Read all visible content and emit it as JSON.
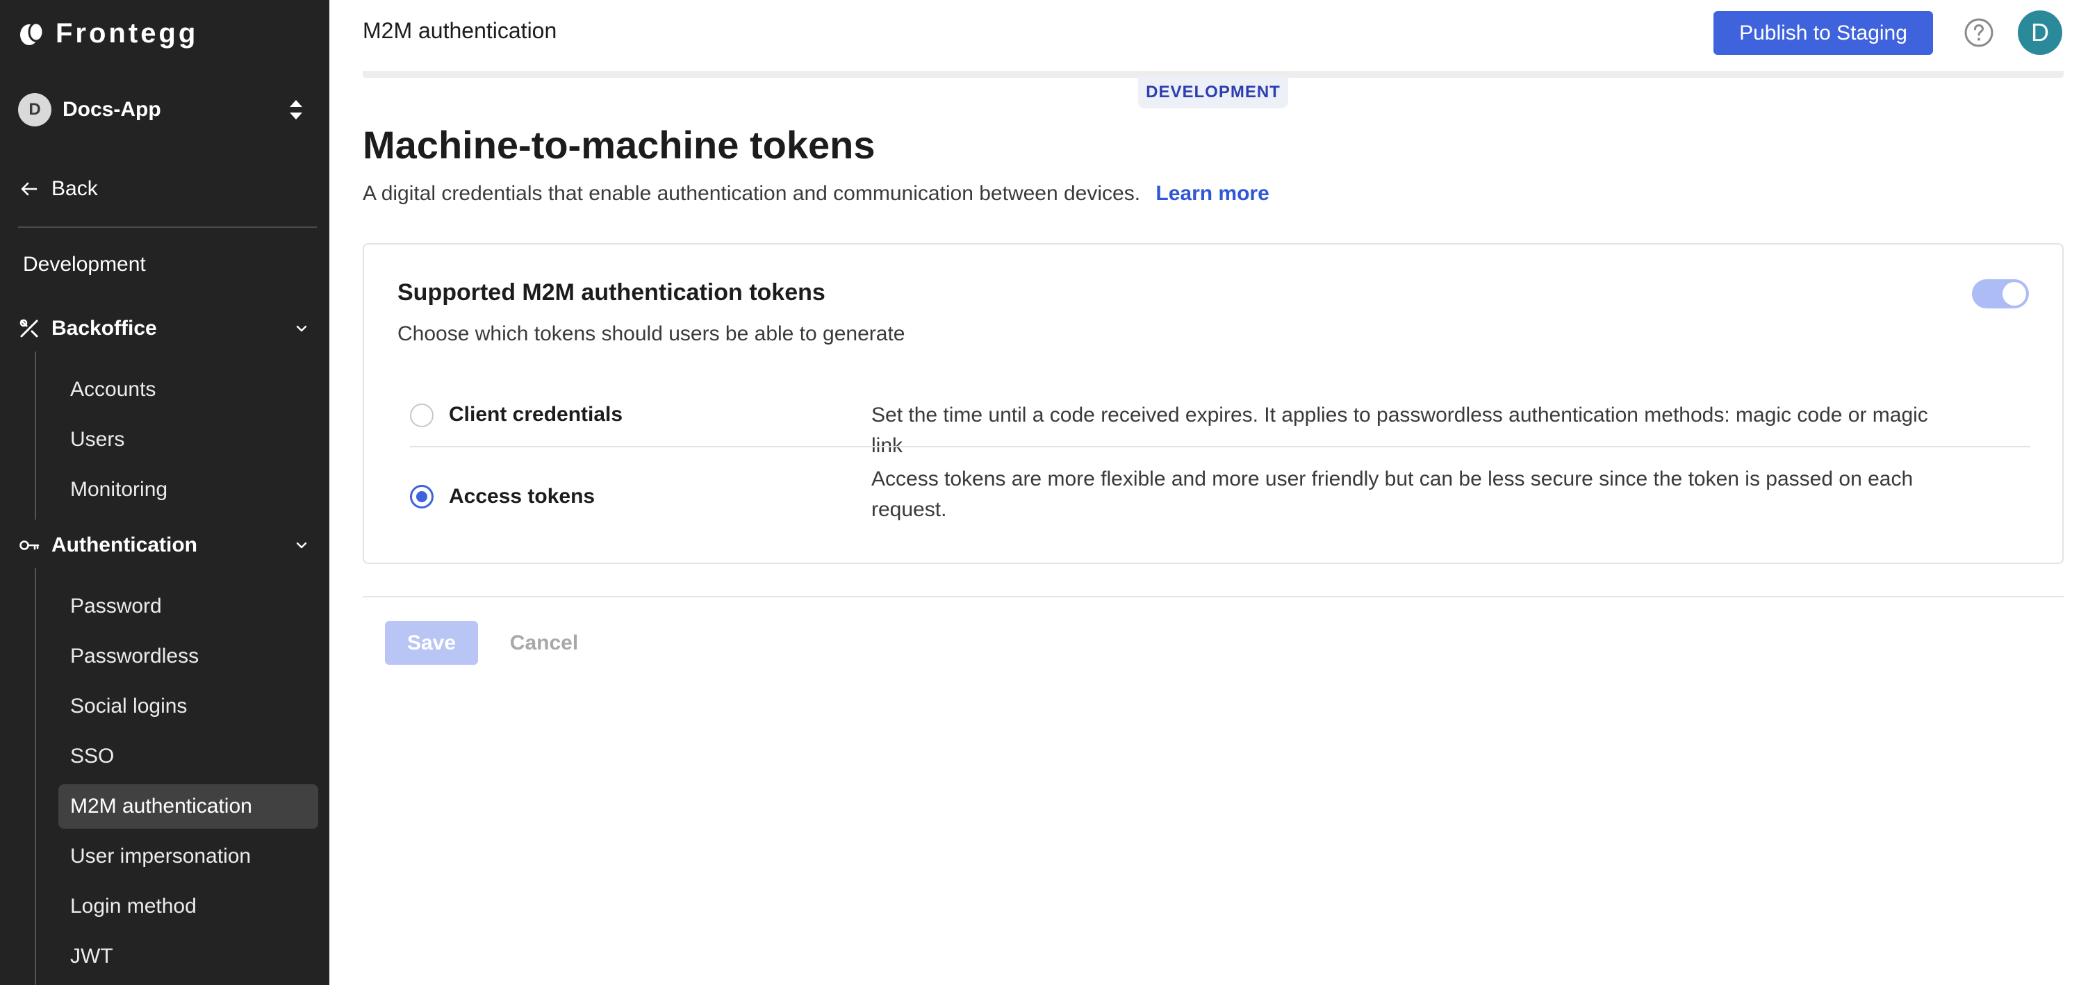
{
  "brand": {
    "name": "Frontegg"
  },
  "app_switcher": {
    "avatar_letter": "D",
    "name": "Docs-App"
  },
  "sidebar": {
    "back_label": "Back",
    "section_title": "Development",
    "groups": [
      {
        "label": "Backoffice",
        "icon": "tools-icon",
        "items": [
          {
            "label": "Accounts"
          },
          {
            "label": "Users"
          },
          {
            "label": "Monitoring"
          }
        ]
      },
      {
        "label": "Authentication",
        "icon": "key-icon",
        "items": [
          {
            "label": "Password"
          },
          {
            "label": "Passwordless"
          },
          {
            "label": "Social logins"
          },
          {
            "label": "SSO"
          },
          {
            "label": "M2M authentication",
            "active": true
          },
          {
            "label": "User impersonation"
          },
          {
            "label": "Login method"
          },
          {
            "label": "JWT"
          }
        ]
      }
    ]
  },
  "header": {
    "title": "M2M authentication",
    "publish_label": "Publish to Staging",
    "user_avatar_letter": "D"
  },
  "environment_badge": "DEVELOPMENT",
  "page": {
    "title": "Machine-to-machine tokens",
    "description": "A digital credentials that enable authentication and communication between devices.",
    "learn_more": "Learn more"
  },
  "card": {
    "title": "Supported M2M authentication tokens",
    "subtitle": "Choose which tokens should users be able to generate",
    "toggle_on": true,
    "options": [
      {
        "label": "Client credentials",
        "selected": false,
        "description": "Set the time until a code received expires. It applies to passwordless authentication methods: magic code or magic link"
      },
      {
        "label": "Access tokens",
        "selected": true,
        "description": "Access tokens are more flexible and more user friendly but can be less secure since the token is passed on each request."
      }
    ]
  },
  "actions": {
    "save_label": "Save",
    "cancel_label": "Cancel"
  },
  "colors": {
    "accent": "#3e63dd",
    "sidebar_bg": "#232323",
    "link": "#2f57d6"
  }
}
